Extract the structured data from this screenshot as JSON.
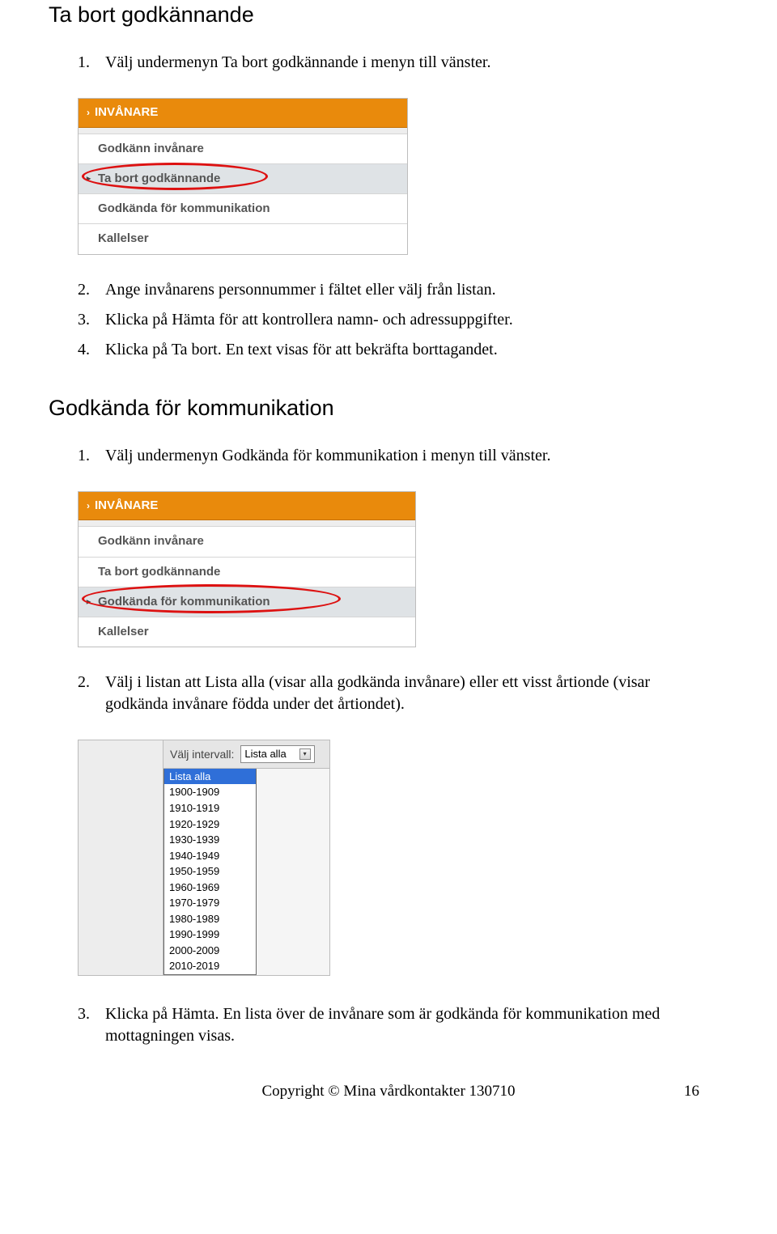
{
  "section1": {
    "title": "Ta bort godkännande",
    "steps": [
      "Välj undermenyn Ta bort godkännande i menyn till vänster.",
      "Ange invånarens personnummer i fältet eller välj från listan.",
      "Klicka på Hämta för att kontrollera namn- och adressuppgifter.",
      "Klicka på Ta bort. En text visas för att bekräfta borttagandet."
    ]
  },
  "menu1": {
    "header": "INVÅNARE",
    "items": [
      "Godkänn invånare",
      "Ta bort godkännande",
      "Godkända för kommunikation",
      "Kallelser"
    ],
    "selectedIndex": 1
  },
  "section2": {
    "title": "Godkända för kommunikation",
    "steps_a": [
      "Välj undermenyn Godkända för kommunikation i menyn till vänster."
    ],
    "steps_b": [
      "Välj i listan att Lista alla (visar alla godkända invånare) eller ett visst årtionde (visar godkända invånare födda under det årtiondet)."
    ],
    "steps_c": [
      "Klicka på Hämta. En lista över de invånare som är godkända för kommunikation med mottagningen visas."
    ]
  },
  "menu2": {
    "header": "INVÅNARE",
    "items": [
      "Godkänn invånare",
      "Ta bort godkännande",
      "Godkända för kommunikation",
      "Kallelser"
    ],
    "selectedIndex": 2
  },
  "interval": {
    "label": "Välj intervall:",
    "selected": "Lista alla",
    "options": [
      "Lista alla",
      "1900-1909",
      "1910-1919",
      "1920-1929",
      "1930-1939",
      "1940-1949",
      "1950-1959",
      "1960-1969",
      "1970-1979",
      "1980-1989",
      "1990-1999",
      "2000-2009",
      "2010-2019"
    ]
  },
  "footer": {
    "text": "Copyright © Mina vårdkontakter 130710",
    "page": "16"
  }
}
